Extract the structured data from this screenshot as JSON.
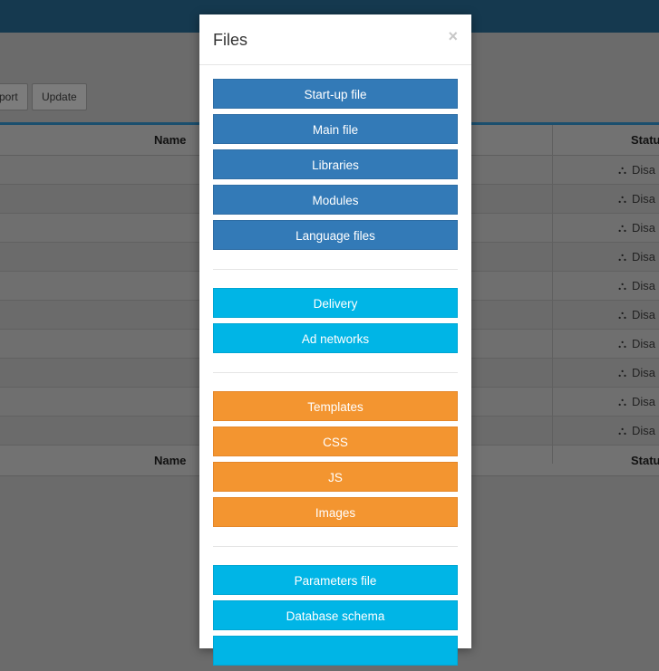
{
  "background": {
    "toolbar": {
      "export_label": "port",
      "update_label": "Update"
    },
    "table": {
      "header": {
        "name": "Name",
        "status": "Statu"
      },
      "footer": {
        "name": "Name",
        "status": "Statu"
      },
      "rows": [
        {
          "status": "Disa"
        },
        {
          "status": "Disa"
        },
        {
          "status": "Disa"
        },
        {
          "status": "Disa"
        },
        {
          "status": "Disa"
        },
        {
          "status": "Disa"
        },
        {
          "status": "Disa"
        },
        {
          "status": "Disa"
        },
        {
          "status": "Disa"
        },
        {
          "status": "Disa"
        }
      ]
    }
  },
  "modal": {
    "title": "Files",
    "close_symbol": "×",
    "groups": {
      "core": [
        "Start-up file",
        "Main file",
        "Libraries",
        "Modules",
        "Language files"
      ],
      "ads": [
        "Delivery",
        "Ad networks"
      ],
      "assets": [
        "Templates",
        "CSS",
        "JS",
        "Images"
      ],
      "data": [
        "Parameters file",
        "Database schema"
      ]
    }
  },
  "colors": {
    "primary": "#337ab7",
    "info": "#00b5e6",
    "warning": "#f39530",
    "topbar": "#15394f"
  }
}
